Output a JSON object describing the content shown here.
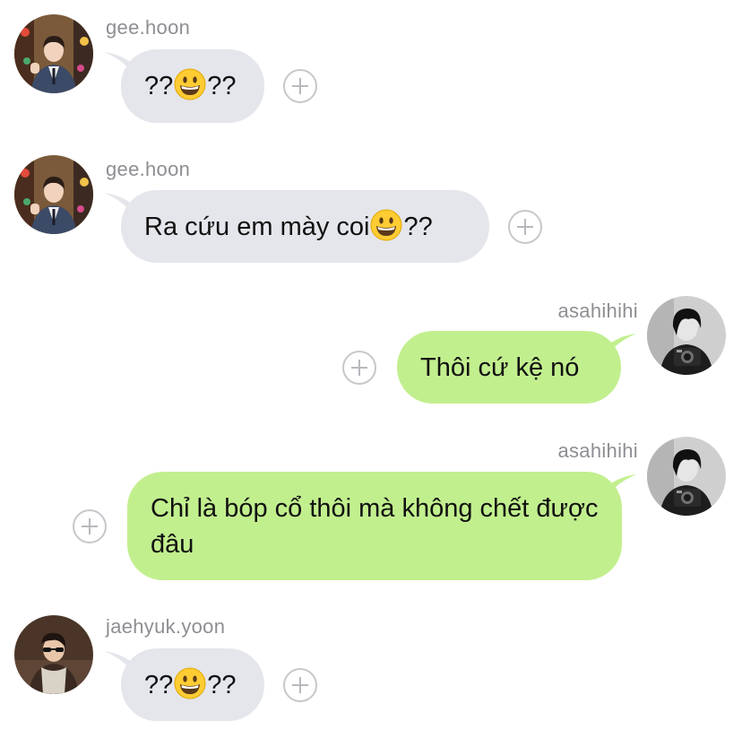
{
  "messages": [
    {
      "sender": "gee.hoon",
      "side": "left",
      "text_before": "??",
      "emoji": "grinning-face",
      "text_after": "??"
    },
    {
      "sender": "gee.hoon",
      "side": "left",
      "text_before": "Ra cứu em mày coi",
      "emoji": "grinning-face",
      "text_after": "??"
    },
    {
      "sender": "asahihihi",
      "side": "right",
      "text": "Thôi cứ kệ nó"
    },
    {
      "sender": "asahihihi",
      "side": "right",
      "text": "Chỉ là bóp cổ thôi mà không chết được đâu"
    },
    {
      "sender": "jaehyuk.yoon",
      "side": "left",
      "text_before": "??",
      "emoji": "grinning-face",
      "text_after": "??"
    }
  ],
  "colors": {
    "incoming_bubble": "#e5e6eb",
    "outgoing_bubble": "#c2ef8e",
    "sender_name": "#8e8e93",
    "plus_icon": "#c7c7cc"
  }
}
